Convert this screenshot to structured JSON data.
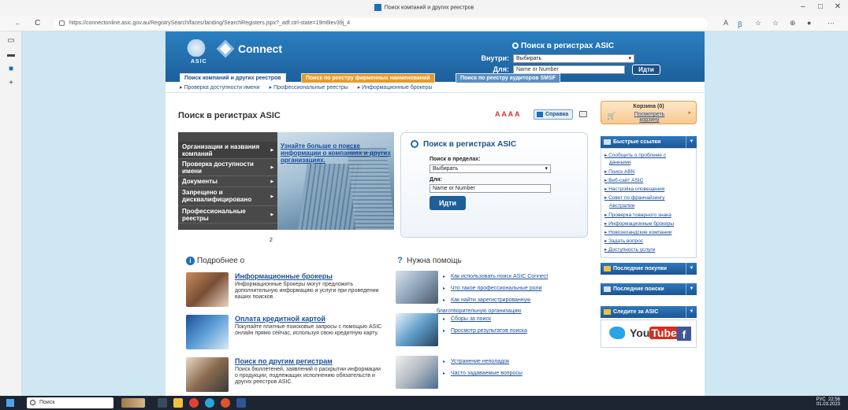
{
  "browser": {
    "tab_title": "Поиск компаний и других реестров",
    "url": "https://connectonline.asic.gov.au/RegistrySearch/faces/landing/SearchRegisters.jspx?_adf.ctrl-state=19m6lev39j_4",
    "win_minimize": "–",
    "win_maximize": "□",
    "win_close": "✕",
    "back": "←",
    "refresh": "C"
  },
  "header": {
    "asic_label": "ASIC",
    "connect_label": "Connect",
    "search_title": "Поиск в регистрах ASIC",
    "inside_label": "Внутри:",
    "inside_value": "Выбирать",
    "for_label": "Для:",
    "for_placeholder": "Name or Number",
    "go_label": "Идти"
  },
  "tabs": [
    {
      "label": "Поиск компаний и других реестров"
    },
    {
      "label": "Поиск по реестру фирменных наименований"
    },
    {
      "label": "Поиск по реестру аудиторов SMSF"
    }
  ],
  "subnav": [
    "▸ Проверка доступности имени",
    "▸ Профессиональные реестры",
    "▸ Информационные брокеры"
  ],
  "main": {
    "page_title": "Поиск в регистрах ASIC",
    "text_size": "A A A A",
    "help_label": "Справка",
    "nav_items": [
      "Организации и названия компаний",
      "Проверка доступности имени",
      "Документы",
      "Запрещено и дисквалифицировано",
      "Профессиональные реестры"
    ],
    "hero_link": "Узнайте больше о поиске информации о компаниях и других организациях.",
    "pager": "2",
    "search_box": {
      "title": "Поиск в регистрах ASIC",
      "within_label": "Поиск в пределах:",
      "within_value": "Выбирать",
      "for_label": "Для:",
      "for_placeholder": "Name or Number",
      "go_label": "Идти"
    }
  },
  "more_about": {
    "title": "Подробнее о",
    "items": [
      {
        "title": "Информационные брокеры",
        "desc": "Информационные брокеры могут предложить дополнительную информацию и услуги при проведении ваших поисков."
      },
      {
        "title": "Оплата кредитной картой",
        "desc": "Покупайте платные поисковые запросы с помощью ASIC онлайн прямо сейчас, используя свою кредитную карту."
      },
      {
        "title": "Поиск по другим регистрам",
        "desc": "Поиск бюллетеней, заявлений о раскрытии информации о продукции, подлежащих исполнению обязательств и других реестров ASIC."
      }
    ]
  },
  "need_help": {
    "title": "Нужна помощь",
    "links": [
      "Как использовать поиск ASIC Connect",
      "Что такое профессиональные роли",
      "Как найти зарегистрированную",
      "благотворительную организацию",
      "Сборы за поиск",
      "Просмотр результатов поиска",
      "Устранение неполадок",
      "Часто задаваемые вопросы"
    ]
  },
  "sidebar": {
    "cart_title": "Корзина (0)",
    "cart_link": "Посмотреть корзину",
    "quick_title": "Быстрые ссылки",
    "quick_links": [
      "▸ Сообщить о проблеме с",
      "данными",
      "▸ Поиск ABN",
      "▸ Веб-сайт ASIC",
      "▸ Настройка оповещения",
      "▸ Совет по франчайзингу",
      "Австралии",
      "▸ Проверка товарного знака",
      "▸ Информационные брокеры",
      "▸ Новозеландские компании",
      "▸ Задать вопрос",
      "▸ Доступность услуги"
    ],
    "recent_purchases": "Последние покупки",
    "recent_searches": "Последние поиски",
    "follow_title": "Следите за ASIC",
    "youtube_you": "You",
    "youtube_tube": "Tube",
    "facebook": "f"
  },
  "taskbar": {
    "search_placeholder": "Поиск",
    "lang": "РУС",
    "time": "22:56",
    "date": "01.03.2023"
  }
}
